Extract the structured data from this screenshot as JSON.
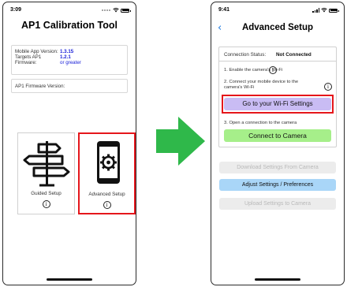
{
  "left_screen": {
    "status_time": "3:09",
    "title": "AP1 Calibration Tool",
    "version_info": {
      "app_label": "Mobile App Version:",
      "app_value": "1.3.15",
      "target_label": "Targets AP1 Firmware:",
      "target_value": "1.2.1",
      "target_sub": "or greater"
    },
    "firmware_label": "AP1 Firmware Version:",
    "tiles": [
      {
        "label": "Guided Setup",
        "info_glyph": "i",
        "icon": "signpost-icon"
      },
      {
        "label": "Advanced Setup",
        "info_glyph": "i",
        "icon": "phone-gear-icon"
      }
    ]
  },
  "arrow": {
    "icon": "arrow-right-icon",
    "color": "#2fb84a"
  },
  "right_screen": {
    "status_time": "9:41",
    "back_glyph": "‹",
    "title": "Advanced Setup",
    "connection_status_label": "Connection Status:",
    "connection_status_value": "Not Connected",
    "step1": "1. Enable the camera's Wi-Fi",
    "step2": "2. Connect your mobile device to the camera's Wi-Fi",
    "step3": "3. Open a connection to the camera",
    "info_glyph": "i",
    "wifi_button": "Go to your Wi-Fi Settings",
    "connect_button": "Connect to Camera",
    "download_button": "Download Settings From Camera",
    "adjust_button": "Adjust Settings / Preferences",
    "upload_button": "Upload Settings to Camera"
  },
  "colors": {
    "highlight": "#e5161b",
    "wifi_button": "#c9bcf4",
    "connect_button": "#a6ef8a",
    "adjust_button": "#a9d6f8",
    "version_values": "#1a20d8",
    "back_chevron": "#1a78e0"
  }
}
